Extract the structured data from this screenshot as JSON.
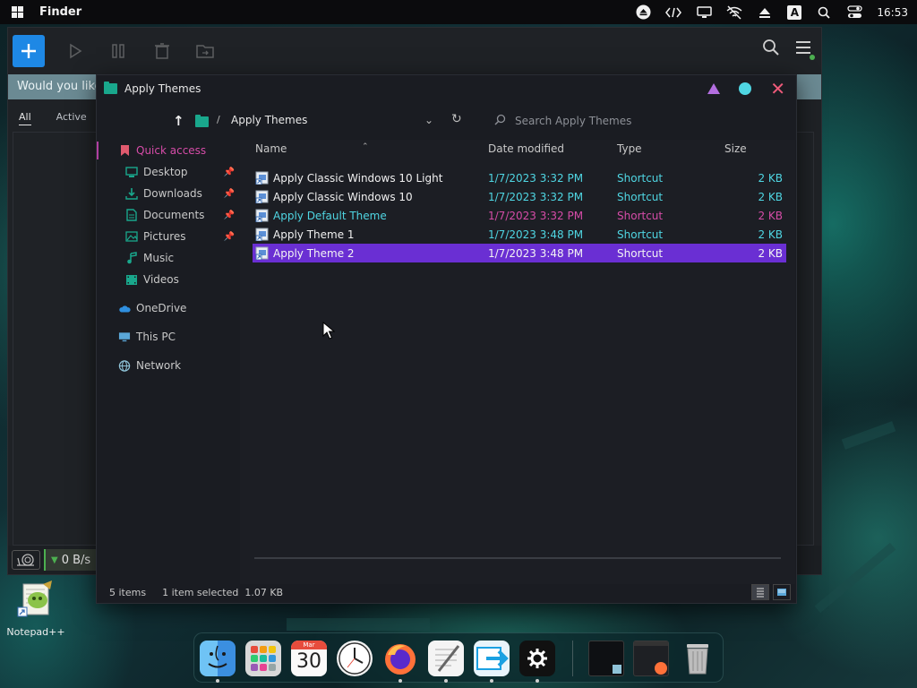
{
  "menubar": {
    "app_name": "Finder",
    "clock": "16:53",
    "keyboard_indicator": "A",
    "icons": [
      "windows-logo-icon",
      "eject-icon",
      "code-icon",
      "monitor-icon",
      "no-network-icon",
      "upload-icon",
      "keyboard-layout-icon",
      "search-icon",
      "control-center-icon"
    ]
  },
  "background_app": {
    "banner_text": "Would you like",
    "tabs": [
      "All",
      "Active"
    ],
    "speed": "0 B/s"
  },
  "explorer": {
    "title": "Apply Themes",
    "breadcrumb": "Apply Themes",
    "search_placeholder": "Search Apply Themes",
    "columns": {
      "name": "Name",
      "date": "Date modified",
      "type": "Type",
      "size": "Size"
    },
    "sidebar": {
      "quick_access": "Quick access",
      "desktop": "Desktop",
      "downloads": "Downloads",
      "documents": "Documents",
      "pictures": "Pictures",
      "music": "Music",
      "videos": "Videos",
      "onedrive": "OneDrive",
      "thispc": "This PC",
      "network": "Network"
    },
    "files": [
      {
        "name": "Apply Classic Windows 10 Light",
        "date": "1/7/2023 3:32 PM",
        "type": "Shortcut",
        "size": "2 KB"
      },
      {
        "name": "Apply Classic Windows 10",
        "date": "1/7/2023 3:32 PM",
        "type": "Shortcut",
        "size": "2 KB"
      },
      {
        "name": "Apply Default Theme",
        "date": "1/7/2023 3:32 PM",
        "type": "Shortcut",
        "size": "2 KB"
      },
      {
        "name": "Apply Theme 1",
        "date": "1/7/2023 3:48 PM",
        "type": "Shortcut",
        "size": "2 KB"
      },
      {
        "name": "Apply Theme 2",
        "date": "1/7/2023 3:48 PM",
        "type": "Shortcut",
        "size": "2 KB"
      }
    ],
    "status": {
      "items": "5 items",
      "selected": "1 item selected",
      "size": "1.07 KB"
    }
  },
  "desktop": {
    "icon_label": "Notepad++"
  },
  "dock": {
    "calendar_month": "Mar",
    "calendar_day": "30",
    "items": [
      "finder",
      "launchpad",
      "calendar",
      "clock",
      "firefox",
      "textedit",
      "migration-assistant",
      "settings",
      "window-thumb-1",
      "window-thumb-2",
      "trash"
    ]
  },
  "colors": {
    "accent_cyan": "#4fd6e3",
    "accent_magenta": "#d64ca8",
    "selection": "#6a2fd3",
    "close": "#ef5a7a",
    "minimize": "#b36ee0"
  }
}
